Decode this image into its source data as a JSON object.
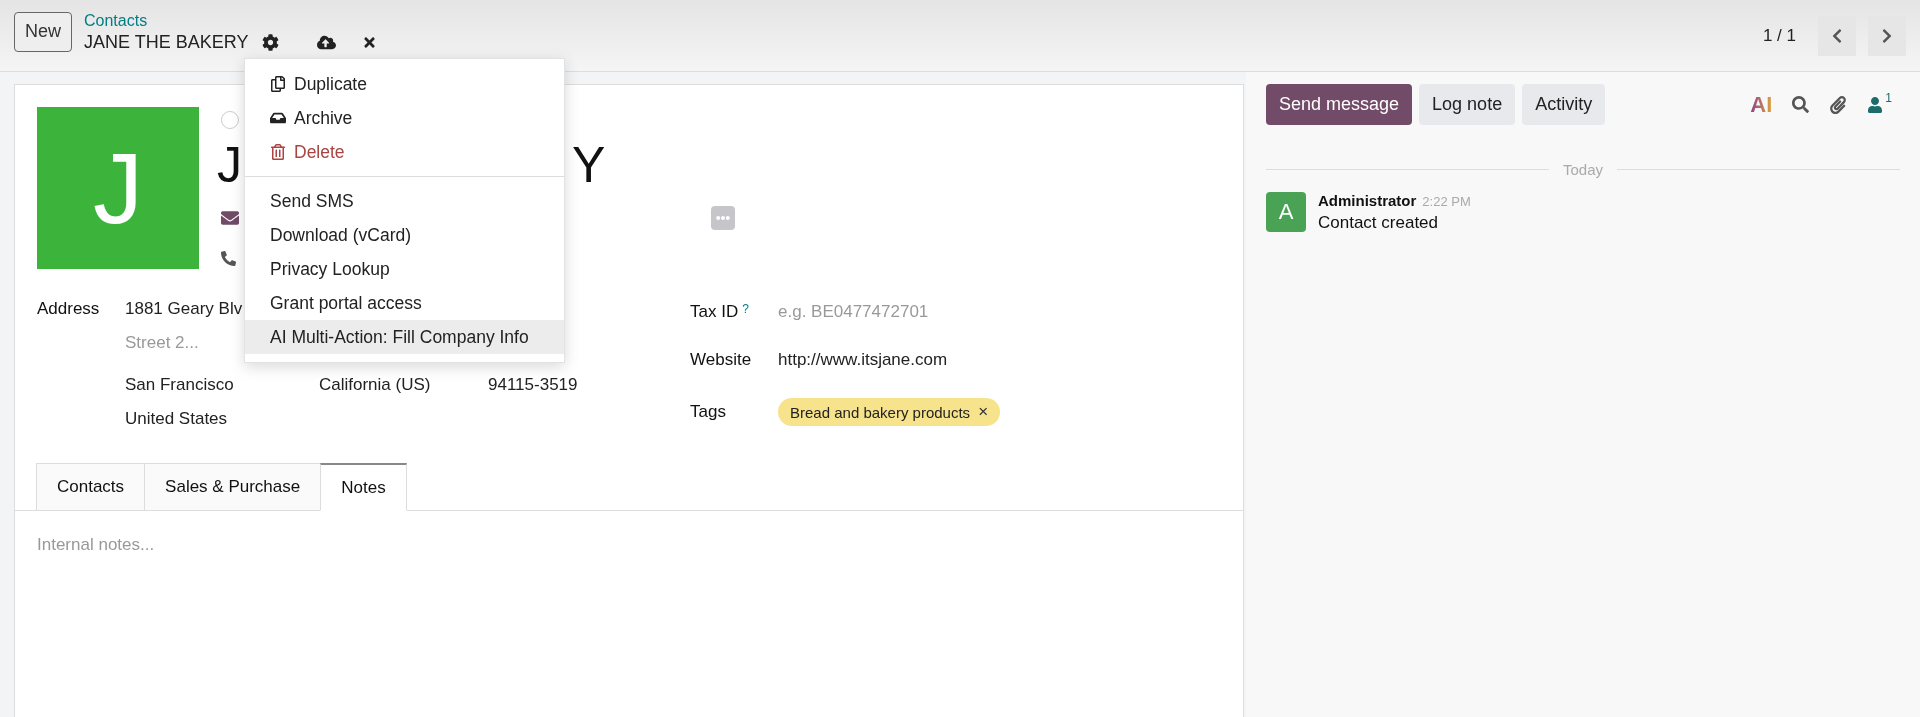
{
  "top_bar": {
    "new_button": "New",
    "breadcrumb": "Contacts",
    "record_title": "JANE THE BAKERY",
    "pager": "1 / 1"
  },
  "action_menu": {
    "groups": [
      {
        "items": [
          {
            "label": "Duplicate",
            "kind": "default",
            "selected": false
          },
          {
            "label": "Archive",
            "kind": "default",
            "selected": false
          },
          {
            "label": "Delete",
            "kind": "danger",
            "selected": false
          }
        ]
      },
      {
        "items": [
          {
            "label": "Send SMS",
            "kind": "default",
            "selected": false
          },
          {
            "label": "Download (vCard)",
            "kind": "default",
            "selected": false
          },
          {
            "label": "Privacy Lookup",
            "kind": "default",
            "selected": false
          },
          {
            "label": "Grant portal access",
            "kind": "default",
            "selected": false
          },
          {
            "label": "AI Multi-Action: Fill Company Info",
            "kind": "default",
            "selected": true
          }
        ]
      }
    ]
  },
  "form": {
    "avatar_letter": "J",
    "priority": {
      "selected": false
    },
    "name_parts": [
      "J",
      "Y"
    ],
    "address": {
      "label": "Address",
      "street": "1881 Geary Blv",
      "street2_placeholder": "Street 2...",
      "city": "San Francisco",
      "state": "California (US)",
      "zip": "94115-3519",
      "country": "United States"
    },
    "fields": [
      {
        "kind": "input",
        "label": "Tax ID",
        "help": "?",
        "placeholder": "e.g. BE0477472701"
      },
      {
        "kind": "text",
        "label": "Website",
        "value": "http://www.itsjane.com"
      },
      {
        "kind": "tags",
        "label": "Tags",
        "tags": [
          {
            "label": "Bread and bakery products",
            "remove": "×"
          }
        ]
      }
    ],
    "tabs": [
      {
        "label": "Contacts",
        "selected": false
      },
      {
        "label": "Sales & Purchase",
        "selected": false
      },
      {
        "label": "Notes",
        "selected": true
      }
    ],
    "notes_placeholder": "Internal notes..."
  },
  "chatter": {
    "buttons": [
      {
        "label": "Send message",
        "selected": true
      },
      {
        "label": "Log note",
        "selected": false
      },
      {
        "label": "Activity",
        "selected": false
      }
    ],
    "ai_logo": "AI",
    "follower_count": "1",
    "date_divider": "Today",
    "messages": [
      {
        "avatar": "A",
        "author": "Administrator",
        "time": "2:22 PM",
        "body": "Contact created"
      }
    ]
  }
}
